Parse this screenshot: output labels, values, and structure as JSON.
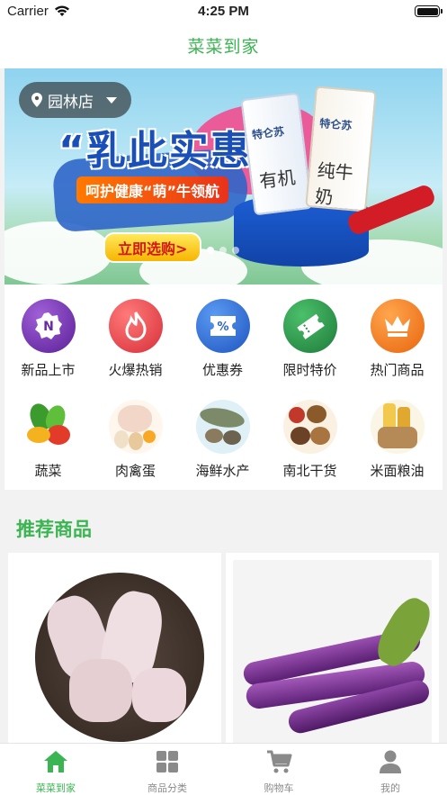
{
  "status_bar": {
    "carrier": "Carrier",
    "time": "4:25 PM"
  },
  "nav": {
    "title": "菜菜到家"
  },
  "banner": {
    "store_label": "园林店",
    "promo_title": "“乳此实惠”",
    "promo_subtitle": "呵护健康“萌”牛领航",
    "promo_cta": "立即选购>",
    "product_left_label": "特仑苏",
    "product_left_text": "有机",
    "product_right_label": "特仑苏",
    "product_right_text": "纯牛奶"
  },
  "categories": [
    {
      "label": "新品上市",
      "icon": "new-badge-icon",
      "color": "#7b3fb0"
    },
    {
      "label": "火爆热销",
      "icon": "fire-icon",
      "color": "#e8413e"
    },
    {
      "label": "优惠券",
      "icon": "coupon-icon",
      "color": "#2d6fd8"
    },
    {
      "label": "限时特价",
      "icon": "ticket-icon",
      "color": "#2e9a4e"
    },
    {
      "label": "热门商品",
      "icon": "crown-icon",
      "color": "#f07a16"
    },
    {
      "label": "蔬菜",
      "icon": "vegetables-image"
    },
    {
      "label": "肉禽蛋",
      "icon": "meat-eggs-image"
    },
    {
      "label": "海鲜水产",
      "icon": "seafood-image"
    },
    {
      "label": "南北干货",
      "icon": "dried-goods-image"
    },
    {
      "label": "米面粮油",
      "icon": "grain-oil-image"
    }
  ],
  "section": {
    "recommend_title": "推荐商品"
  },
  "products": [
    {
      "name": "frog-meat-image"
    },
    {
      "name": "eggplant-image"
    }
  ],
  "tabbar": {
    "items": [
      {
        "label": "菜菜到家",
        "icon": "home-icon",
        "active": true
      },
      {
        "label": "商品分类",
        "icon": "grid-icon",
        "active": false
      },
      {
        "label": "购物车",
        "icon": "cart-icon",
        "active": false
      },
      {
        "label": "我的",
        "icon": "user-icon",
        "active": false
      }
    ]
  },
  "colors": {
    "accent": "#3bb552",
    "inactive": "#8a8a8a"
  }
}
